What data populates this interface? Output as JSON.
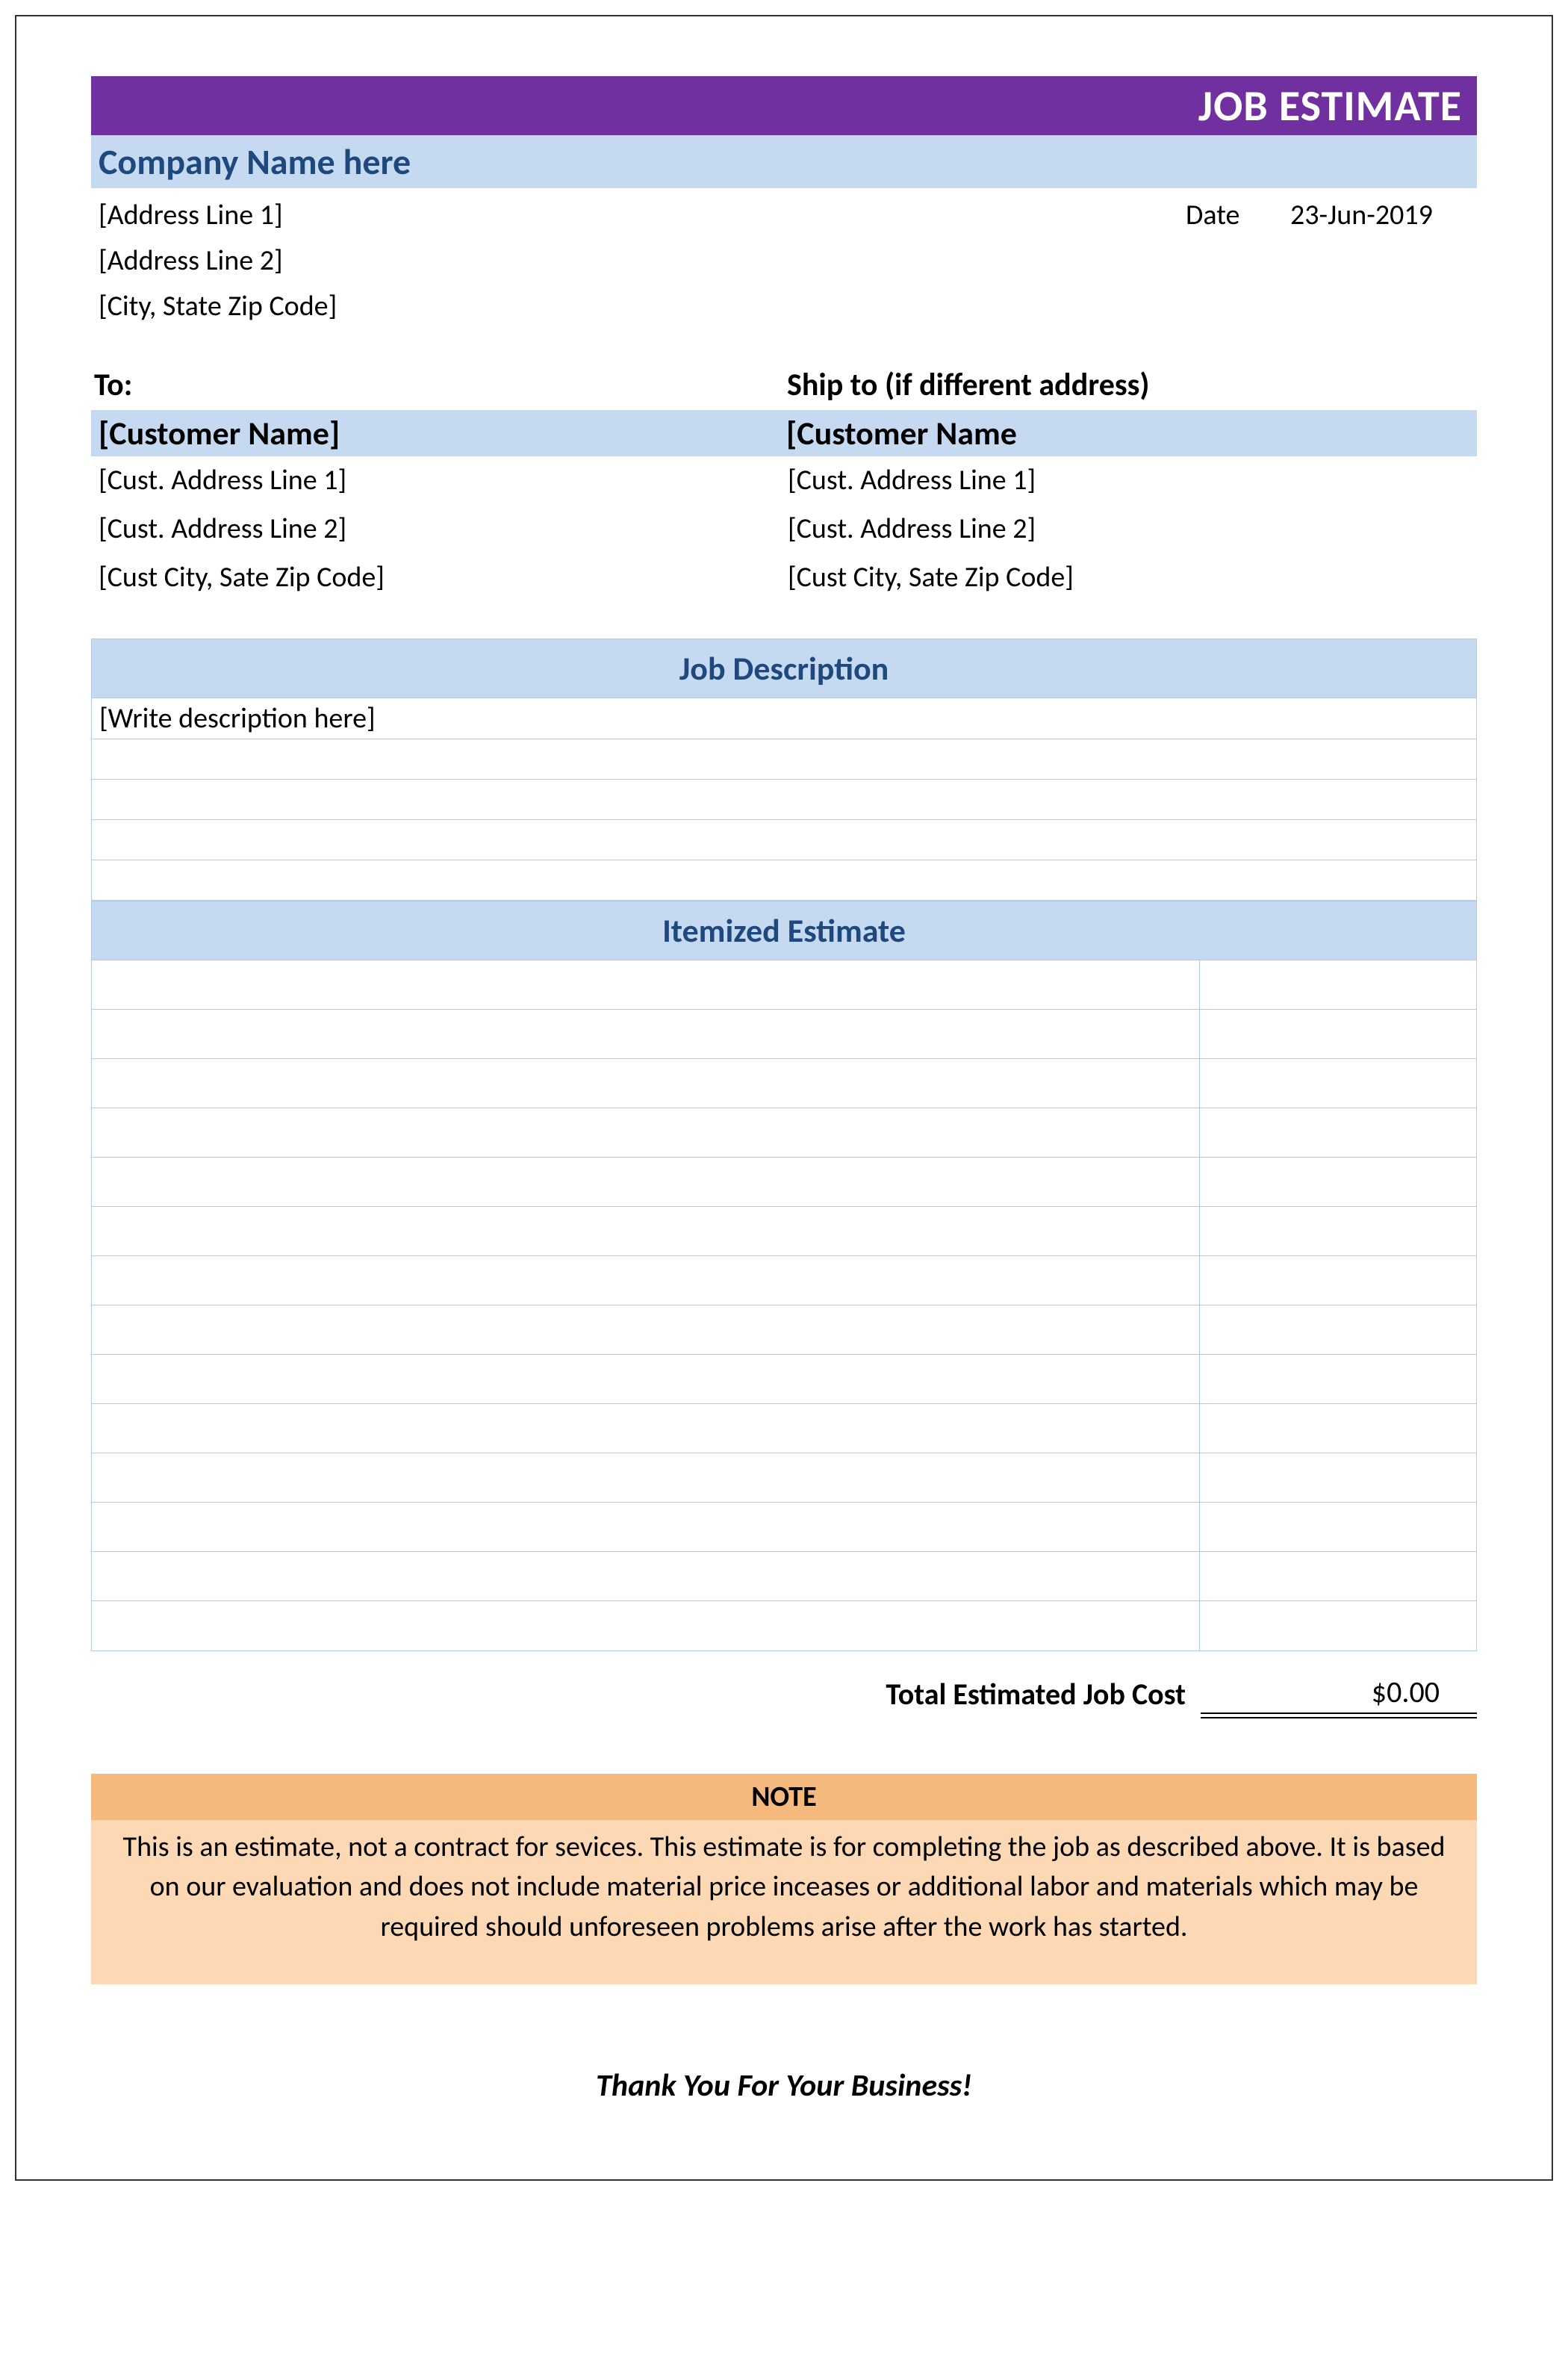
{
  "title": "JOB ESTIMATE",
  "company": {
    "name": "Company Name here",
    "addr1": "[Address Line 1]",
    "addr2": "[Address Line 2]",
    "city": "[City, State Zip Code]"
  },
  "date": {
    "label": "Date",
    "value": "23-Jun-2019"
  },
  "to": {
    "heading": "To:",
    "name": "[Customer Name]",
    "addr1": "[Cust. Address Line 1]",
    "addr2": "[Cust. Address Line 2]",
    "city": "[Cust City, Sate Zip Code]"
  },
  "ship_to": {
    "heading": "Ship to (if different address)",
    "name": "[Customer Name",
    "addr1": "[Cust. Address Line 1]",
    "addr2": "[Cust. Address Line 2]",
    "city": "[Cust City, Sate Zip Code]"
  },
  "job_description": {
    "header": "Job Description",
    "placeholder": "[Write description here]"
  },
  "itemized": {
    "header": "Itemized Estimate"
  },
  "total": {
    "label": "Total Estimated Job Cost",
    "value": "$0.00"
  },
  "note": {
    "header": "NOTE",
    "body": "This is an estimate, not a contract for sevices. This estimate is for completing the job as described above. It is based on our evaluation and does not include material price inceases or additional labor and materials which may be required should unforeseen problems arise after the work has started."
  },
  "footer": "Thank You For Your Business!"
}
